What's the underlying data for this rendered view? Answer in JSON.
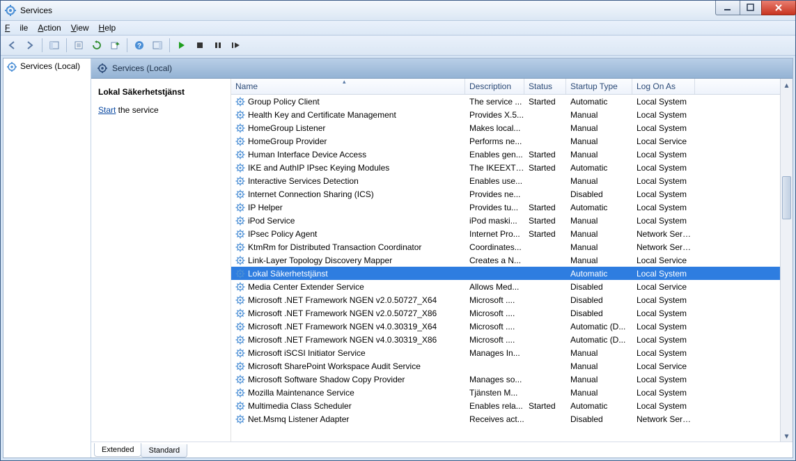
{
  "window": {
    "title": "Services"
  },
  "menubar": {
    "file": "File",
    "action": "Action",
    "view": "View",
    "help": "Help"
  },
  "left": {
    "root": "Services (Local)"
  },
  "right": {
    "header": "Services (Local)",
    "selected_title": "Lokal Säkerhetstjänst",
    "action_link": "Start",
    "action_suffix": " the service"
  },
  "columns": {
    "name": "Name",
    "desc": "Description",
    "status": "Status",
    "startup": "Startup Type",
    "logon": "Log On As"
  },
  "tabs": {
    "extended": "Extended",
    "standard": "Standard"
  },
  "services": [
    {
      "name": "Group Policy Client",
      "desc": "The service ...",
      "status": "Started",
      "startup": "Automatic",
      "logon": "Local System"
    },
    {
      "name": "Health Key and Certificate Management",
      "desc": "Provides X.5...",
      "status": "",
      "startup": "Manual",
      "logon": "Local System"
    },
    {
      "name": "HomeGroup Listener",
      "desc": "Makes local...",
      "status": "",
      "startup": "Manual",
      "logon": "Local System"
    },
    {
      "name": "HomeGroup Provider",
      "desc": "Performs ne...",
      "status": "",
      "startup": "Manual",
      "logon": "Local Service"
    },
    {
      "name": "Human Interface Device Access",
      "desc": "Enables gen...",
      "status": "Started",
      "startup": "Manual",
      "logon": "Local System"
    },
    {
      "name": "IKE and AuthIP IPsec Keying Modules",
      "desc": "The IKEEXT ...",
      "status": "Started",
      "startup": "Automatic",
      "logon": "Local System"
    },
    {
      "name": "Interactive Services Detection",
      "desc": "Enables use...",
      "status": "",
      "startup": "Manual",
      "logon": "Local System"
    },
    {
      "name": "Internet Connection Sharing (ICS)",
      "desc": "Provides ne...",
      "status": "",
      "startup": "Disabled",
      "logon": "Local System"
    },
    {
      "name": "IP Helper",
      "desc": "Provides tu...",
      "status": "Started",
      "startup": "Automatic",
      "logon": "Local System"
    },
    {
      "name": "iPod Service",
      "desc": "iPod maski...",
      "status": "Started",
      "startup": "Manual",
      "logon": "Local System"
    },
    {
      "name": "IPsec Policy Agent",
      "desc": "Internet Pro...",
      "status": "Started",
      "startup": "Manual",
      "logon": "Network Service"
    },
    {
      "name": "KtmRm for Distributed Transaction Coordinator",
      "desc": "Coordinates...",
      "status": "",
      "startup": "Manual",
      "logon": "Network Service"
    },
    {
      "name": "Link-Layer Topology Discovery Mapper",
      "desc": "Creates a N...",
      "status": "",
      "startup": "Manual",
      "logon": "Local Service"
    },
    {
      "name": "Lokal Säkerhetstjänst",
      "desc": "",
      "status": "",
      "startup": "Automatic",
      "logon": "Local System",
      "selected": true
    },
    {
      "name": "Media Center Extender Service",
      "desc": "Allows Med...",
      "status": "",
      "startup": "Disabled",
      "logon": "Local Service"
    },
    {
      "name": "Microsoft .NET Framework NGEN v2.0.50727_X64",
      "desc": "Microsoft ....",
      "status": "",
      "startup": "Disabled",
      "logon": "Local System"
    },
    {
      "name": "Microsoft .NET Framework NGEN v2.0.50727_X86",
      "desc": "Microsoft ....",
      "status": "",
      "startup": "Disabled",
      "logon": "Local System"
    },
    {
      "name": "Microsoft .NET Framework NGEN v4.0.30319_X64",
      "desc": "Microsoft ....",
      "status": "",
      "startup": "Automatic (D...",
      "logon": "Local System"
    },
    {
      "name": "Microsoft .NET Framework NGEN v4.0.30319_X86",
      "desc": "Microsoft ....",
      "status": "",
      "startup": "Automatic (D...",
      "logon": "Local System"
    },
    {
      "name": "Microsoft iSCSI Initiator Service",
      "desc": "Manages In...",
      "status": "",
      "startup": "Manual",
      "logon": "Local System"
    },
    {
      "name": "Microsoft SharePoint Workspace Audit Service",
      "desc": "",
      "status": "",
      "startup": "Manual",
      "logon": "Local Service"
    },
    {
      "name": "Microsoft Software Shadow Copy Provider",
      "desc": "Manages so...",
      "status": "",
      "startup": "Manual",
      "logon": "Local System"
    },
    {
      "name": "Mozilla Maintenance Service",
      "desc": "Tjänsten M...",
      "status": "",
      "startup": "Manual",
      "logon": "Local System"
    },
    {
      "name": "Multimedia Class Scheduler",
      "desc": "Enables rela...",
      "status": "Started",
      "startup": "Automatic",
      "logon": "Local System"
    },
    {
      "name": "Net.Msmq Listener Adapter",
      "desc": "Receives act...",
      "status": "",
      "startup": "Disabled",
      "logon": "Network Service"
    }
  ]
}
